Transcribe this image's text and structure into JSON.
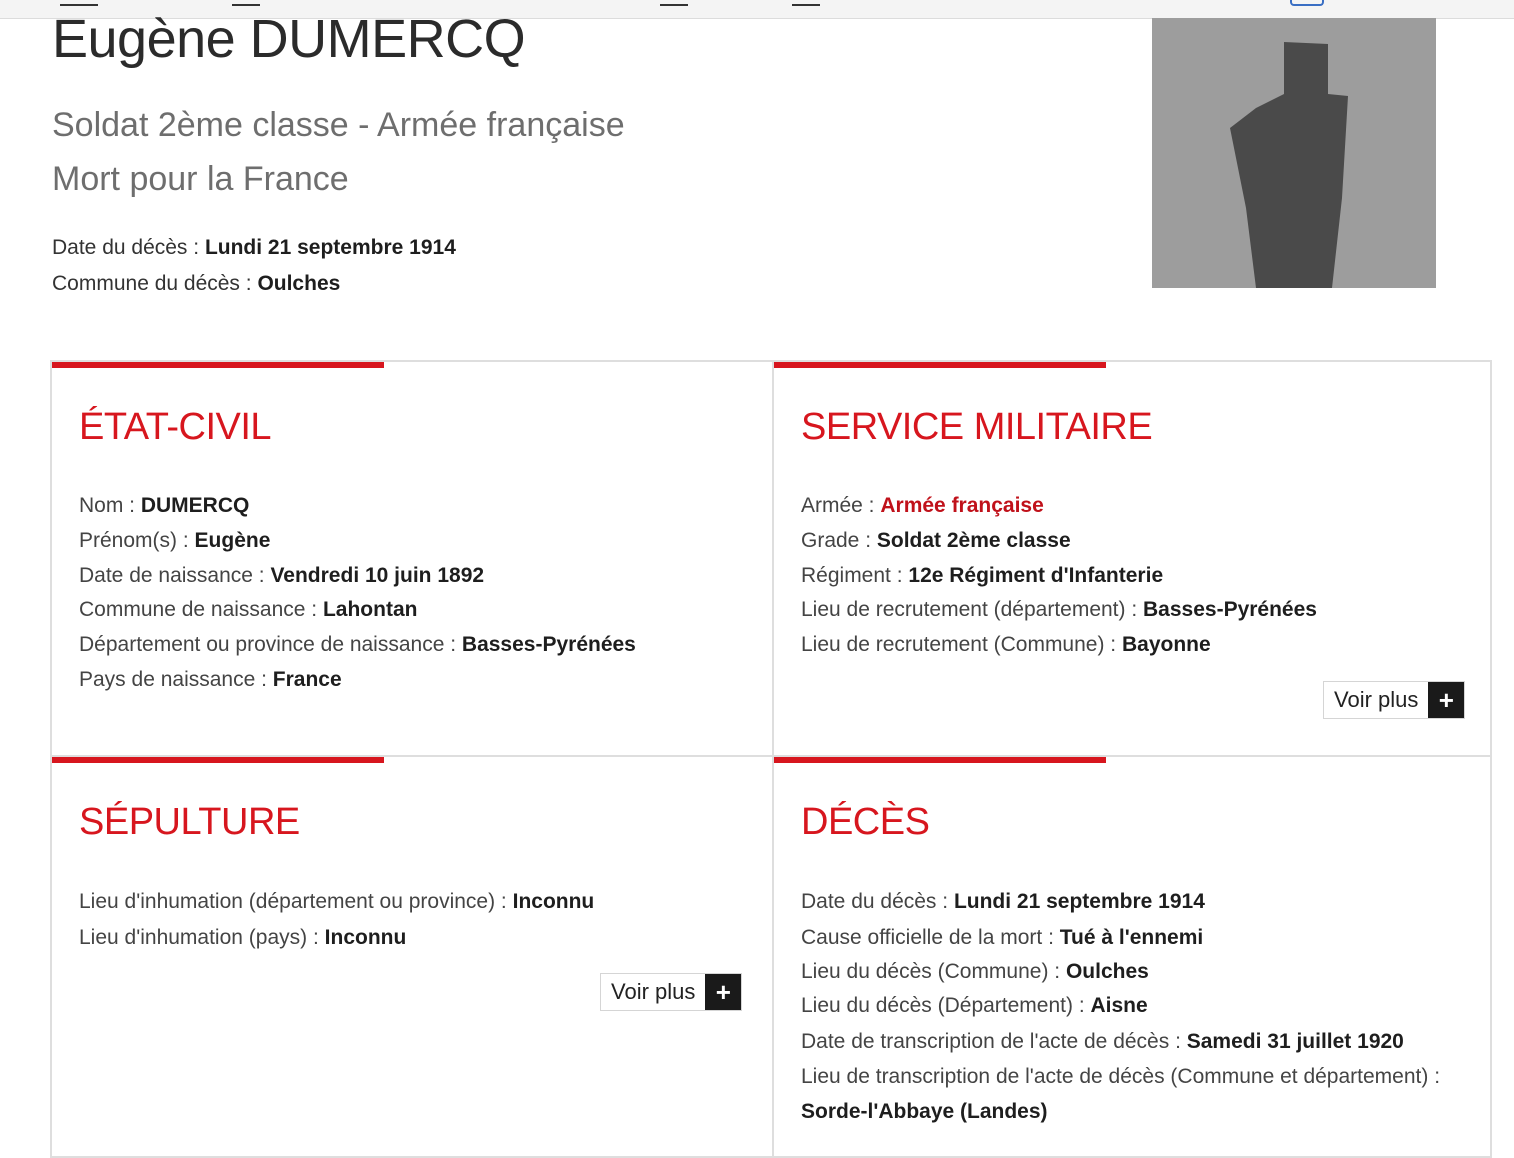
{
  "person": {
    "name": "Eugène DUMERCQ",
    "rank_line": "Soldat 2ème classe - Armée française",
    "status_line": "Mort pour la France",
    "death_date_label": "Date du décès : ",
    "death_date_value": "Lundi 21 septembre 1914",
    "death_commune_label": "Commune du décès : ",
    "death_commune_value": "Oulches"
  },
  "etat_civil": {
    "title": "ÉTAT-CIVIL",
    "fields": [
      {
        "label": "Nom : ",
        "value": "DUMERCQ"
      },
      {
        "label": "Prénom(s) : ",
        "value": "Eugène"
      },
      {
        "label": "Date de naissance : ",
        "value": "Vendredi 10 juin 1892"
      },
      {
        "label": "Commune de naissance : ",
        "value": "Lahontan"
      },
      {
        "label": "Département ou province de naissance : ",
        "value": "Basses-Pyrénées"
      },
      {
        "label": "Pays de naissance : ",
        "value": "France"
      }
    ]
  },
  "service_militaire": {
    "title": "SERVICE MILITAIRE",
    "fields": [
      {
        "label": "Armée : ",
        "value": "Armée française"
      },
      {
        "label": "Grade : ",
        "value": "Soldat 2ème classe"
      },
      {
        "label": "Régiment : ",
        "value": "12e Régiment d'Infanterie"
      },
      {
        "label": "Lieu de recrutement (département) : ",
        "value": "Basses-Pyrénées"
      },
      {
        "label": "Lieu de recrutement (Commune) : ",
        "value": "Bayonne"
      }
    ],
    "more_label": "Voir plus",
    "more_icon": "+"
  },
  "sepulture": {
    "title": "SÉPULTURE",
    "fields": [
      {
        "label": "Lieu d'inhumation (département ou province) : ",
        "value": "Inconnu"
      },
      {
        "label": "Lieu d'inhumation (pays) : ",
        "value": "Inconnu"
      }
    ],
    "more_label": "Voir plus",
    "more_icon": "+"
  },
  "deces": {
    "title": "DÉCÈS",
    "fields": [
      {
        "label": "Date du décès : ",
        "value": "Lundi 21 septembre 1914"
      },
      {
        "label": "Cause officielle de la mort : ",
        "value": "Tué à l'ennemi"
      },
      {
        "label": "Lieu du décès (Commune) : ",
        "value": "Oulches"
      },
      {
        "label": "Lieu du décès (Département) : ",
        "value": "Aisne"
      },
      {
        "label": "Date de transcription de l'acte de décès : ",
        "value": "Samedi 31 juillet 1920"
      },
      {
        "label": "Lieu de transcription de l'acte de décès (Commune et département) : ",
        "value": "Sorde-l'Abbaye (Landes)"
      }
    ]
  },
  "colors": {
    "accent": "#d7161e",
    "link_red": "#c0111a",
    "photo_bg": "#9d9d9d",
    "silhouette": "#4a4a4a"
  },
  "icons": {
    "portrait": "person-silhouette-icon",
    "more": "plus-icon"
  }
}
